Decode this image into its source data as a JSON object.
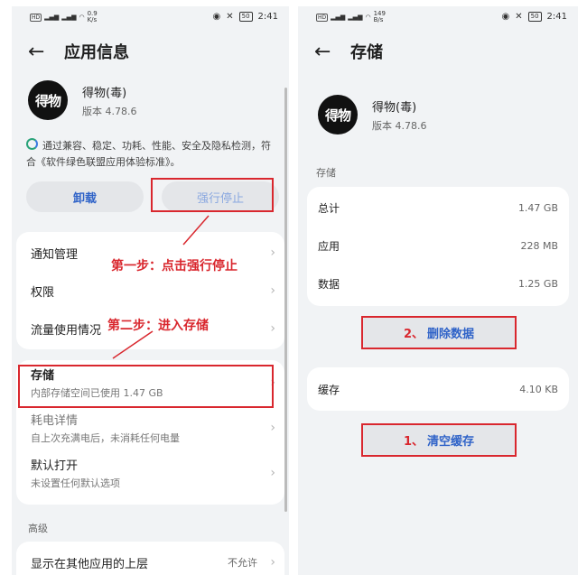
{
  "left": {
    "status": {
      "net": "0.9\nK/s",
      "time": "2:41",
      "battery": "50"
    },
    "title": "应用信息",
    "app": {
      "logo_text": "得物",
      "name": "得物(毒)",
      "version": "版本 4.78.6"
    },
    "notice": "通过兼容、稳定、功耗、性能、安全及隐私检测，符合《软件绿色联盟应用体验标准》。",
    "buttons": {
      "uninstall": "卸载",
      "force_stop": "强行停止"
    },
    "menu": [
      {
        "label": "通知管理"
      },
      {
        "label": "权限"
      },
      {
        "label": "流量使用情况"
      }
    ],
    "storage": {
      "label": "存储",
      "sub": "内部存储空间已使用 1.47 GB"
    },
    "power": {
      "label": "耗电详情",
      "sub": "自上次充满电后，未消耗任何电量"
    },
    "default_open": {
      "label": "默认打开",
      "sub": "未设置任何默认选项"
    },
    "section_advanced": "高级",
    "overlay": {
      "label": "显示在其他应用的上层",
      "value": "不允许"
    },
    "annot1": "第一步：点击强行停止",
    "annot2": "第二步：进入存储"
  },
  "right": {
    "status": {
      "net": "149\nB/s",
      "time": "2:41",
      "battery": "50"
    },
    "title": "存储",
    "app": {
      "logo_text": "得物",
      "name": "得物(毒)",
      "version": "版本 4.78.6"
    },
    "section_storage": "存储",
    "rows": [
      {
        "k": "总计",
        "v": "1.47 GB"
      },
      {
        "k": "应用",
        "v": "228 MB"
      },
      {
        "k": "数据",
        "v": "1.25 GB"
      }
    ],
    "delete_btn": {
      "num": "2、",
      "label": "删除数据"
    },
    "cache": {
      "k": "缓存",
      "v": "4.10 KB"
    },
    "clear_btn": {
      "num": "1、",
      "label": "清空缓存"
    }
  }
}
